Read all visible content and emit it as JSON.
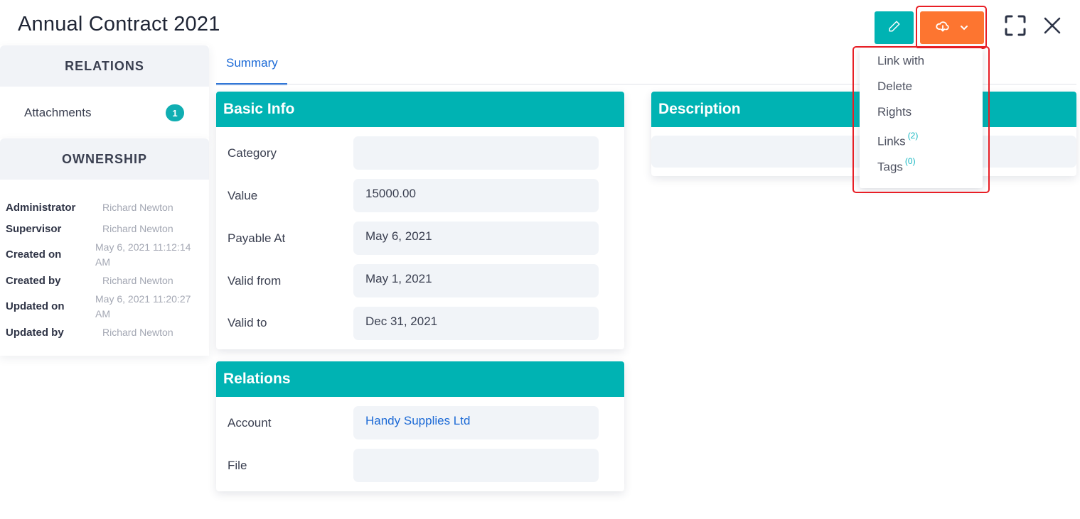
{
  "header": {
    "title": "Annual Contract 2021",
    "edit_icon": "pencil-icon",
    "actions_icon": "cloud-download-icon",
    "actions_chevron": "chevron-down-icon",
    "fullscreen_icon": "fullscreen-icon",
    "close_icon": "close-icon"
  },
  "colors": {
    "teal": "#00b3b3",
    "orange": "#fd7530",
    "link_blue": "#1c6ad6",
    "highlight_red": "#e81e25"
  },
  "actions_menu": {
    "items": [
      {
        "label": "Link with"
      },
      {
        "label": "Delete"
      },
      {
        "label": "Rights"
      },
      {
        "label": "Links",
        "count": "(2)"
      },
      {
        "label": "Tags",
        "count": "(0)"
      }
    ]
  },
  "sidebar": {
    "relations_title": "RELATIONS",
    "attachments_label": "Attachments",
    "attachments_count": "1",
    "ownership_title": "OWNERSHIP",
    "ownership": [
      {
        "key": "Administrator",
        "value": "Richard Newton"
      },
      {
        "key": "Supervisor",
        "value": "Richard Newton"
      },
      {
        "key": "Created on",
        "value": "May 6, 2021 11:12:14 AM"
      },
      {
        "key": "Created by",
        "value": "Richard Newton"
      },
      {
        "key": "Updated on",
        "value": "May 6, 2021 11:20:27 AM"
      },
      {
        "key": "Updated by",
        "value": "Richard Newton"
      }
    ]
  },
  "tabs": [
    {
      "label": "Summary",
      "active": true
    }
  ],
  "basic_info": {
    "title": "Basic Info",
    "fields": [
      {
        "label": "Category",
        "value": ""
      },
      {
        "label": "Value",
        "value": "15000.00"
      },
      {
        "label": "Payable At",
        "value": "May 6, 2021"
      },
      {
        "label": "Valid from",
        "value": "May 1, 2021"
      },
      {
        "label": "Valid to",
        "value": "Dec 31, 2021"
      }
    ]
  },
  "relations": {
    "title": "Relations",
    "fields": [
      {
        "label": "Account",
        "value": "Handy Supplies Ltd"
      },
      {
        "label": "File",
        "value": ""
      }
    ]
  },
  "description": {
    "title": "Description",
    "value": ""
  }
}
